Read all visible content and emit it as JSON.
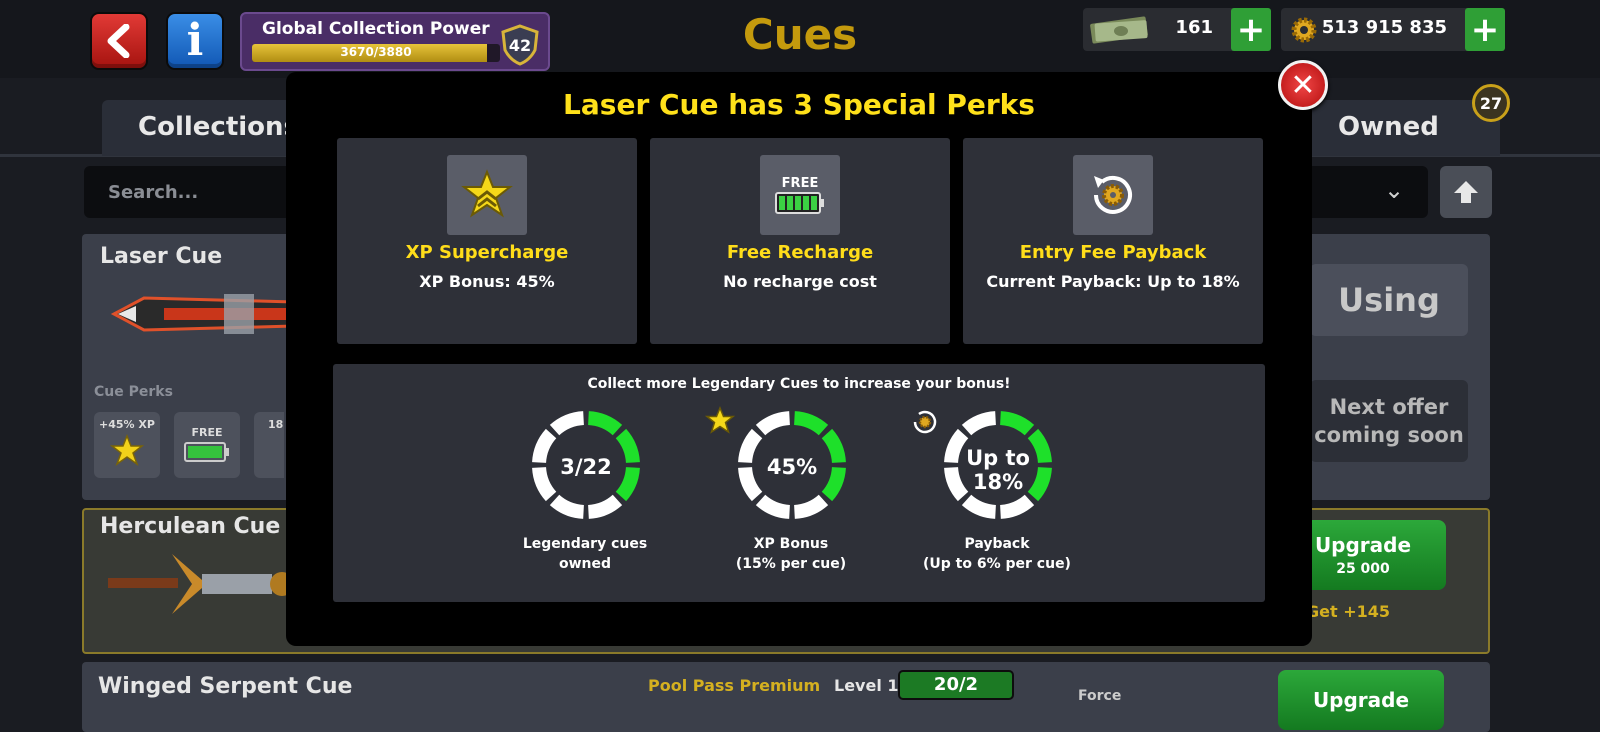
{
  "header": {
    "title": "Cues",
    "collection_power": {
      "label": "Global Collection Power",
      "progress_text": "3670/3880",
      "progress_fraction": 0.946,
      "level": "42"
    },
    "cash": {
      "value": "161"
    },
    "coins": {
      "value": "513 915 835"
    }
  },
  "tabs": {
    "collections": "Collections",
    "owned": "Owned",
    "owned_count": "27"
  },
  "search": {
    "placeholder": "Search..."
  },
  "cues": [
    {
      "name": "Laser Cue",
      "perks_label": "Cue Perks",
      "perk_chip_xp": "+45% XP",
      "perk_chip_free": "FREE",
      "perk_chip_payback": "18",
      "button": "Using",
      "offer": "Next offer coming soon"
    },
    {
      "name": "Herculean Cue",
      "button": "Upgrade",
      "cost": "25 000",
      "get": "Get +145"
    },
    {
      "name": "Winged Serpent Cue",
      "pass": "Pool Pass Premium",
      "level": "Level 1",
      "progress_text": "20/2",
      "stat": "Force",
      "button": "Upgrade"
    }
  ],
  "modal": {
    "title": "Laser Cue has 3 Special Perks",
    "perks": [
      {
        "name": "XP Supercharge",
        "desc": "XP Bonus: 45%",
        "icon": "xp-star-icon"
      },
      {
        "name": "Free Recharge",
        "desc": "No recharge cost",
        "icon": "battery-icon",
        "icon_text": "FREE"
      },
      {
        "name": "Entry Fee Payback",
        "desc": "Current Payback: Up to 18%",
        "icon": "payback-icon"
      }
    ],
    "bonus": {
      "title": "Collect more Legendary Cues to increase your bonus!",
      "rings": [
        {
          "value": "3/22",
          "label_1": "Legendary cues",
          "label_2": "owned",
          "segments_filled": 3
        },
        {
          "value": "45%",
          "label_1": "XP Bonus",
          "label_2": "(15% per cue)",
          "segments_filled": 3
        },
        {
          "value_1": "Up to",
          "value_2": "18%",
          "label_1": "Payback",
          "label_2": "(Up to 6% per cue)",
          "segments_filled": 3
        }
      ]
    }
  },
  "colors": {
    "accent_yellow": "#ffdd1a",
    "green": "#2ca83a",
    "title_gold": "#c49a0d"
  }
}
